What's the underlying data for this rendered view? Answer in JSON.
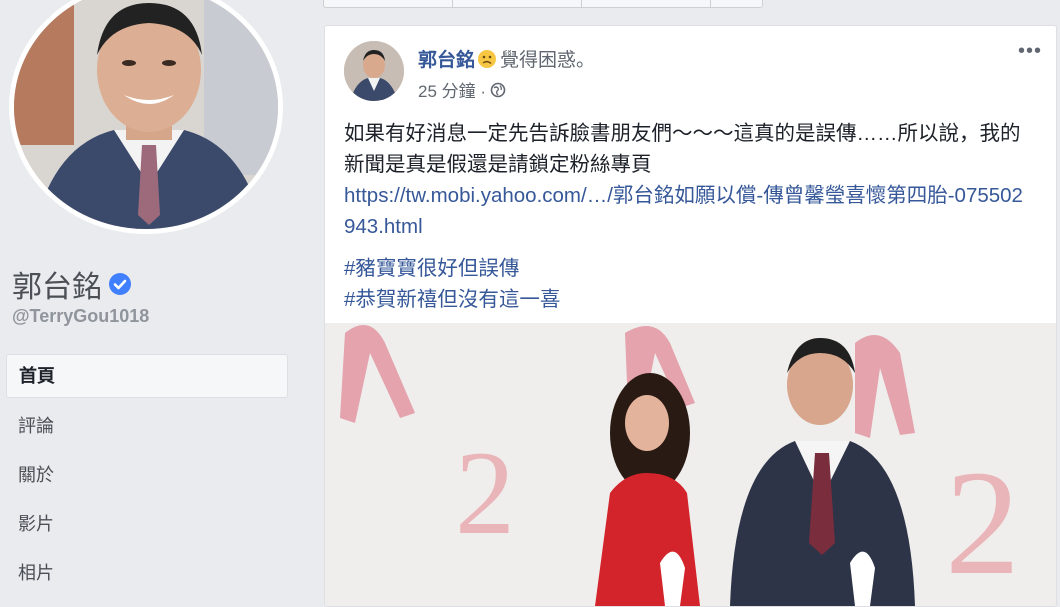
{
  "page": {
    "name": "郭台銘",
    "handle": "@TerryGou1018",
    "verified_icon": "verified-check-icon"
  },
  "nav": {
    "items": [
      {
        "label": "首頁",
        "active": true
      },
      {
        "label": "評論"
      },
      {
        "label": "關於"
      },
      {
        "label": "影片"
      },
      {
        "label": "相片"
      }
    ]
  },
  "post": {
    "author": "郭台銘",
    "feeling_icon": "confused-face-icon",
    "feeling": "覺得困惑。",
    "timestamp": "25 分鐘 ·",
    "privacy_icon": "globe-icon",
    "more_label": "•••",
    "text": "如果有好消息一定先告訴臉書朋友們～～～這真的是誤傳……所以說，我的新聞是真是假還是請鎖定粉絲專頁",
    "link": "https://tw.mobi.yahoo.com/…/郭台銘如願以償-傳曾馨瑩喜懷第四胎-075502943.html",
    "hashtags": [
      "#豬寶寶很好但誤傳",
      "#恭賀新禧但沒有這一喜"
    ]
  },
  "colors": {
    "link_blue": "#365899",
    "verified_blue": "#4080ff",
    "background": "#e9ebee"
  }
}
